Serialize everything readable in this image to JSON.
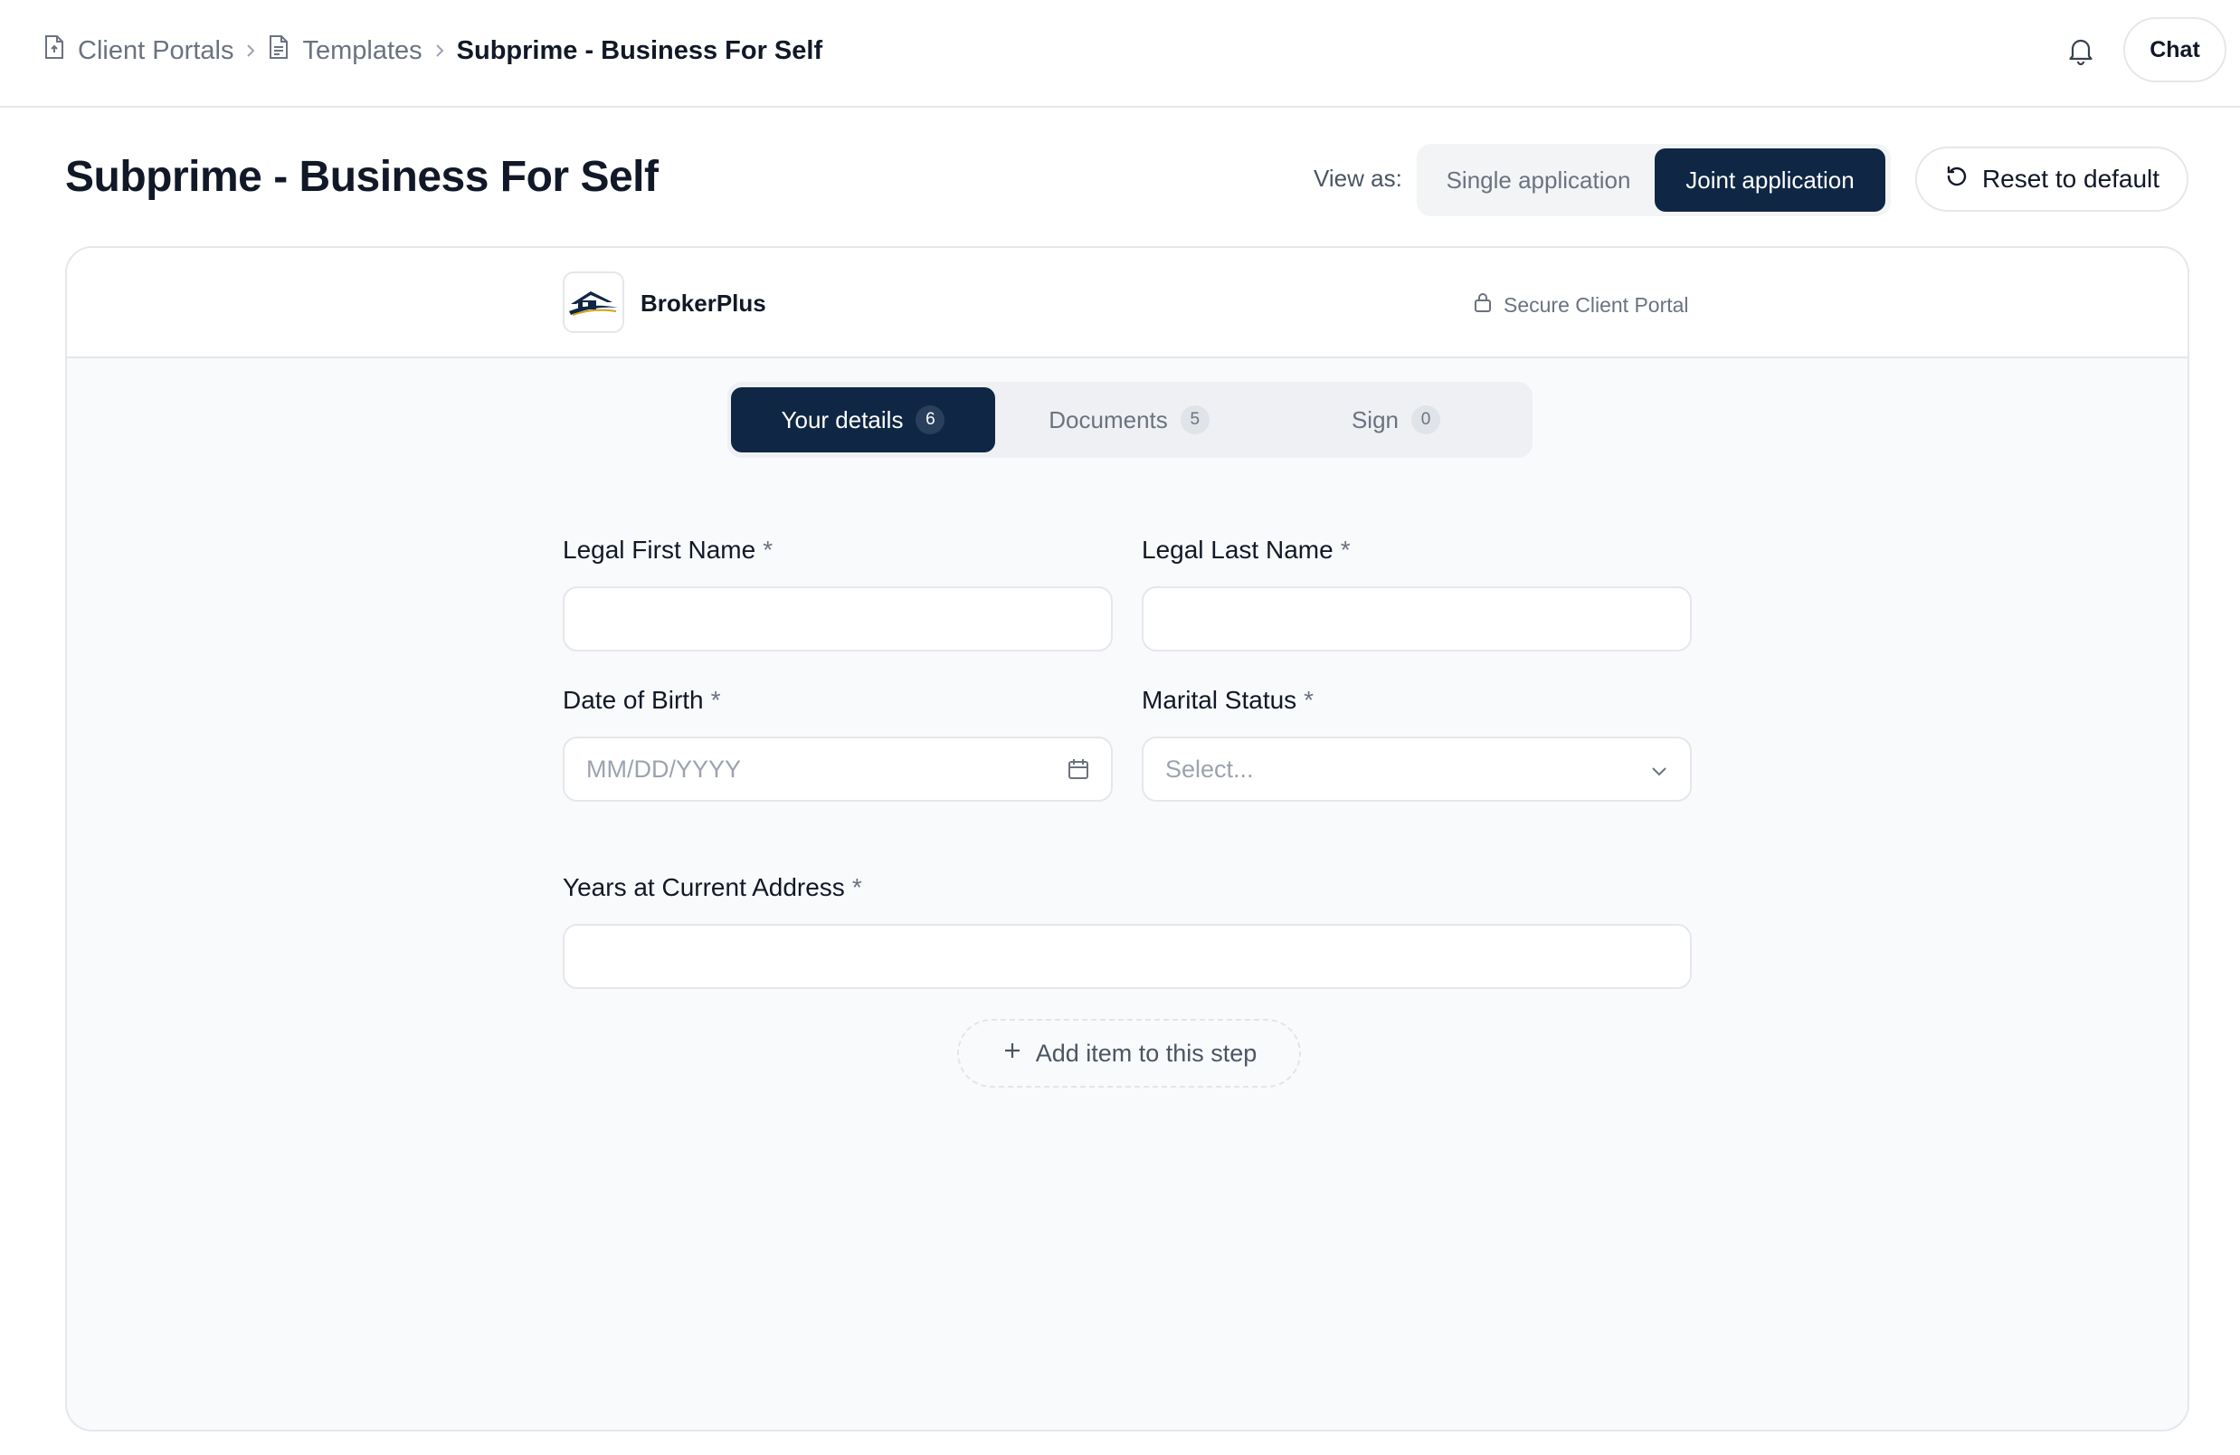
{
  "breadcrumb": {
    "items": [
      {
        "label": "Client Portals",
        "icon": "document-upload-icon"
      },
      {
        "label": "Templates",
        "icon": "document-text-icon"
      },
      {
        "label": "Subprime - Business For Self"
      }
    ]
  },
  "topbar": {
    "chat_label": "Chat",
    "bell_icon": "bell-icon"
  },
  "page": {
    "title": "Subprime - Business For Self",
    "view_as_label": "View as:",
    "view_options": [
      "Single application",
      "Joint application"
    ],
    "selected_view": "Joint application",
    "reset_label": "Reset to default"
  },
  "portal": {
    "brand_name": "BrokerPlus",
    "secure_label": "Secure Client Portal",
    "steps": [
      {
        "label": "Your details",
        "count": "6",
        "active": true
      },
      {
        "label": "Documents",
        "count": "5",
        "active": false
      },
      {
        "label": "Sign",
        "count": "0",
        "active": false
      }
    ],
    "fields": {
      "first_name": {
        "label": "Legal First Name",
        "required": "*",
        "value": ""
      },
      "last_name": {
        "label": "Legal Last Name",
        "required": "*",
        "value": ""
      },
      "dob": {
        "label": "Date of Birth",
        "required": "*",
        "placeholder": "MM/DD/YYYY",
        "icon": "calendar-icon"
      },
      "marital": {
        "label": "Marital Status",
        "required": "*",
        "placeholder": "Select...",
        "icon": "chevron-down-icon"
      },
      "years_address": {
        "label": "Years at Current Address",
        "required": "*",
        "value": ""
      }
    },
    "add_item_label": "Add item to this step"
  },
  "colors": {
    "primary": "#0f2744",
    "border": "#e5e7eb",
    "muted_text": "#6b7280",
    "card_bg": "#f9fafb"
  }
}
